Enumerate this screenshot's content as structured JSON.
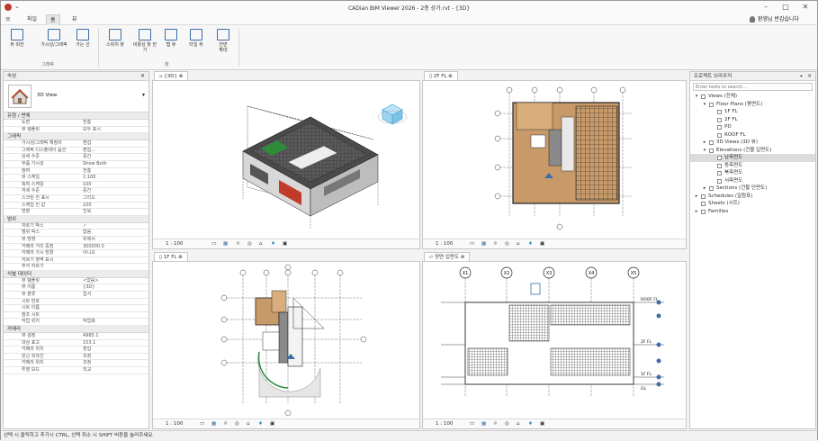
{
  "app": {
    "title": "CADian BIM Viewer 2026 - 2층 상가.rvt - {3D}"
  },
  "menu": {
    "items": [
      "파일",
      "홈",
      "뷰"
    ],
    "user": "환영님 반갑습니다"
  },
  "ribbon": {
    "buttons": [
      {
        "label": "뷰 회전",
        "icon": "view-rotate-icon"
      },
      {
        "label": "가시성/그래픽",
        "icon": "visibility-icon"
      },
      {
        "label": "가는 선",
        "icon": "thin-lines-icon"
      },
      {
        "label": "스위치 창",
        "icon": "switch-window-icon"
      },
      {
        "label": "비활성 창 닫기",
        "icon": "close-inactive-icon"
      },
      {
        "label": "탭 뷰",
        "icon": "tab-view-icon"
      },
      {
        "label": "타일 뷰",
        "icon": "tile-view-icon"
      },
      {
        "label": "전면\n확대",
        "icon": "zoom-icon"
      }
    ],
    "groups": {
      "graphics": "그래픽",
      "window": "창"
    }
  },
  "properties": {
    "header": "속성",
    "type_label": "3D View",
    "sections": [
      {
        "title": "유형 / 변체",
        "rows": [
          [
            "도면",
            "전층"
          ],
          [
            "뷰 템플릿",
            "모두 표시"
          ]
        ]
      },
      {
        "title": "그래픽",
        "rows": [
          [
            "가시성/그래픽 재정의",
            "편집"
          ],
          [
            "그래픽 디스플레이 옵션",
            "편집..."
          ],
          [
            "상세 수준",
            "중간"
          ],
          [
            "부품 가시성",
            "Show Both"
          ],
          [
            "참여",
            "전층"
          ],
          [
            "뷰 스케일",
            "1:100"
          ],
          [
            "축척 스케일",
            "100"
          ],
          [
            "자세 수준",
            "중간"
          ],
          [
            "스크린 진 표시",
            "그리드"
          ],
          [
            "스케일 진 값",
            "100"
          ],
          [
            "방향",
            "진북"
          ]
        ]
      },
      {
        "title": "범위",
        "rows": [
          [
            "자르기 박스",
            "✓"
          ],
          [
            "범위 박스",
            "없음"
          ],
          [
            "뷰 방향",
            "위에서"
          ],
          [
            "카메라 거리 중점",
            "300000.0"
          ],
          [
            "카메라 가시 방향",
            "아니오"
          ],
          [
            "자르기 영역 표시",
            ""
          ],
          [
            "주석 자르기",
            ""
          ]
        ]
      },
      {
        "title": "식별 데이터",
        "rows": [
          [
            "뷰 템플릿",
            "<없음>"
          ],
          [
            "뷰 이름",
            "{3D}"
          ],
          [
            "뷰 분류",
            "업서"
          ],
          [
            "시트 번호",
            ""
          ],
          [
            "시트 이름",
            ""
          ],
          [
            "참조 시트",
            ""
          ],
          [
            "작업 위치",
            "작업축"
          ]
        ]
      },
      {
        "title": "카메라",
        "rows": [
          [
            "뷰 설정",
            "4985.1"
          ],
          [
            "대상 표고",
            "153.1"
          ],
          [
            "카메라 위치",
            "편집"
          ],
          [
            "원근 외곽선",
            "조정"
          ],
          [
            "카메라 위치",
            "조정"
          ],
          [
            "투영 모드",
            "직교"
          ]
        ]
      }
    ]
  },
  "views": {
    "v3d": {
      "tab": "{3D}",
      "scale": "1 : 100"
    },
    "v2f": {
      "tab": "2F FL",
      "scale": "1 : 100"
    },
    "v1f": {
      "tab": "1F FL",
      "scale": "1 : 100"
    },
    "velev": {
      "tab": "정면 입면도",
      "scale": "1 : 100"
    }
  },
  "elevation": {
    "grids": [
      "X1",
      "X2",
      "X3",
      "X4",
      "X5"
    ],
    "levels": [
      "ROOF FL",
      "2F FL",
      "1F FL",
      "GL"
    ]
  },
  "browser": {
    "header": "프로젝트 브라우저",
    "search_placeholder": "Enter texts to search...",
    "tree": [
      {
        "label": "Views (전체)",
        "depth": 0,
        "toggle": "-"
      },
      {
        "label": "Floor Plans (평면도)",
        "depth": 1,
        "toggle": "-"
      },
      {
        "label": "1F FL",
        "depth": 2
      },
      {
        "label": "2F FL",
        "depth": 2
      },
      {
        "label": "PD",
        "depth": 2
      },
      {
        "label": "ROOF FL",
        "depth": 2
      },
      {
        "label": "3D Views (3D 뷰)",
        "depth": 1,
        "toggle": "+"
      },
      {
        "label": "Elevations (건물 입면도)",
        "depth": 1,
        "toggle": "-"
      },
      {
        "label": "남측면도",
        "depth": 2,
        "selected": true
      },
      {
        "label": "동측면도",
        "depth": 2
      },
      {
        "label": "북측면도",
        "depth": 2
      },
      {
        "label": "서측면도",
        "depth": 2
      },
      {
        "label": "Sections (건물 단면도)",
        "depth": 1,
        "toggle": "+"
      },
      {
        "label": "Schedules (일람표)",
        "depth": 0,
        "toggle": "+"
      },
      {
        "label": "Sheets (시트)",
        "depth": 0,
        "toggle": ""
      },
      {
        "label": "Families",
        "depth": 0,
        "toggle": "+"
      }
    ]
  },
  "status": {
    "text": "선택 시 클릭하고 추가시 CTRL, 선택 취소 시 SHIFT 버튼을 눌러주세요."
  },
  "colors": {
    "floor": "#c89a6a",
    "accent": "#3b6ea5",
    "green": "#2e8b3a",
    "red": "#c23a2a"
  }
}
